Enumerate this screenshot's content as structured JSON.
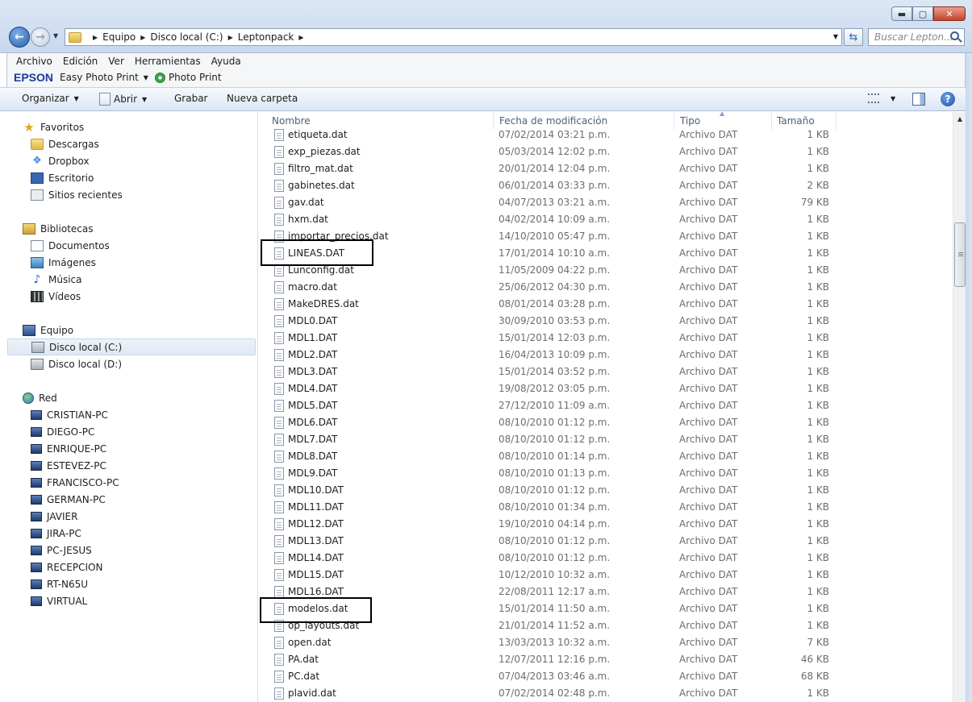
{
  "address": {
    "crumbs": [
      "Equipo",
      "Disco local (C:)",
      "Leptonpack"
    ]
  },
  "search": {
    "placeholder": "Buscar Lepton..."
  },
  "menu": [
    "Archivo",
    "Edición",
    "Ver",
    "Herramientas",
    "Ayuda"
  ],
  "epson": {
    "brand": "EPSON",
    "app": "Easy Photo Print",
    "photo_print": "Photo Print"
  },
  "toolbar": {
    "organize": "Organizar",
    "open": "Abrir",
    "burn": "Grabar",
    "new_folder": "Nueva carpeta"
  },
  "nav": {
    "favorites": "Favoritos",
    "downloads": "Descargas",
    "dropbox": "Dropbox",
    "desktop": "Escritorio",
    "recent": "Sitios recientes",
    "libraries": "Bibliotecas",
    "documents": "Documentos",
    "images": "Imágenes",
    "music": "Música",
    "videos": "Vídeos",
    "computer": "Equipo",
    "disk_c": "Disco local (C:)",
    "disk_d": "Disco local (D:)",
    "network": "Red",
    "hosts": [
      "CRISTIAN-PC",
      "DIEGO-PC",
      "ENRIQUE-PC",
      "ESTEVEZ-PC",
      "FRANCISCO-PC",
      "GERMAN-PC",
      "JAVIER",
      "JIRA-PC",
      "PC-JESUS",
      "RECEPCION",
      "RT-N65U",
      "VIRTUAL"
    ]
  },
  "columns": {
    "name": "Nombre",
    "date": "Fecha de modificación",
    "type": "Tipo",
    "size": "Tamaño"
  },
  "files": [
    {
      "name": "etiqueta.dat",
      "date": "07/02/2014 03:21 p.m.",
      "type": "Archivo DAT",
      "size": "1 KB"
    },
    {
      "name": "exp_piezas.dat",
      "date": "05/03/2014 12:02 p.m.",
      "type": "Archivo DAT",
      "size": "1 KB"
    },
    {
      "name": "filtro_mat.dat",
      "date": "20/01/2014 12:04 p.m.",
      "type": "Archivo DAT",
      "size": "1 KB"
    },
    {
      "name": "gabinetes.dat",
      "date": "06/01/2014 03:33 p.m.",
      "type": "Archivo DAT",
      "size": "2 KB"
    },
    {
      "name": "gav.dat",
      "date": "04/07/2013 03:21 a.m.",
      "type": "Archivo DAT",
      "size": "79 KB"
    },
    {
      "name": "hxm.dat",
      "date": "04/02/2014 10:09 a.m.",
      "type": "Archivo DAT",
      "size": "1 KB"
    },
    {
      "name": "importar_precios.dat",
      "date": "14/10/2010 05:47 p.m.",
      "type": "Archivo DAT",
      "size": "1 KB"
    },
    {
      "name": "LINEAS.DAT",
      "date": "17/01/2014 10:10 a.m.",
      "type": "Archivo DAT",
      "size": "1 KB"
    },
    {
      "name": "Lunconfig.dat",
      "date": "11/05/2009 04:22 p.m.",
      "type": "Archivo DAT",
      "size": "1 KB"
    },
    {
      "name": "macro.dat",
      "date": "25/06/2012 04:30 p.m.",
      "type": "Archivo DAT",
      "size": "1 KB"
    },
    {
      "name": "MakeDRES.dat",
      "date": "08/01/2014 03:28 p.m.",
      "type": "Archivo DAT",
      "size": "1 KB"
    },
    {
      "name": "MDL0.DAT",
      "date": "30/09/2010 03:53 p.m.",
      "type": "Archivo DAT",
      "size": "1 KB"
    },
    {
      "name": "MDL1.DAT",
      "date": "15/01/2014 12:03 p.m.",
      "type": "Archivo DAT",
      "size": "1 KB"
    },
    {
      "name": "MDL2.DAT",
      "date": "16/04/2013 10:09 p.m.",
      "type": "Archivo DAT",
      "size": "1 KB"
    },
    {
      "name": "MDL3.DAT",
      "date": "15/01/2014 03:52 p.m.",
      "type": "Archivo DAT",
      "size": "1 KB"
    },
    {
      "name": "MDL4.DAT",
      "date": "19/08/2012 03:05 p.m.",
      "type": "Archivo DAT",
      "size": "1 KB"
    },
    {
      "name": "MDL5.DAT",
      "date": "27/12/2010 11:09 a.m.",
      "type": "Archivo DAT",
      "size": "1 KB"
    },
    {
      "name": "MDL6.DAT",
      "date": "08/10/2010 01:12 p.m.",
      "type": "Archivo DAT",
      "size": "1 KB"
    },
    {
      "name": "MDL7.DAT",
      "date": "08/10/2010 01:12 p.m.",
      "type": "Archivo DAT",
      "size": "1 KB"
    },
    {
      "name": "MDL8.DAT",
      "date": "08/10/2010 01:14 p.m.",
      "type": "Archivo DAT",
      "size": "1 KB"
    },
    {
      "name": "MDL9.DAT",
      "date": "08/10/2010 01:13 p.m.",
      "type": "Archivo DAT",
      "size": "1 KB"
    },
    {
      "name": "MDL10.DAT",
      "date": "08/10/2010 01:12 p.m.",
      "type": "Archivo DAT",
      "size": "1 KB"
    },
    {
      "name": "MDL11.DAT",
      "date": "08/10/2010 01:34 p.m.",
      "type": "Archivo DAT",
      "size": "1 KB"
    },
    {
      "name": "MDL12.DAT",
      "date": "19/10/2010 04:14 p.m.",
      "type": "Archivo DAT",
      "size": "1 KB"
    },
    {
      "name": "MDL13.DAT",
      "date": "08/10/2010 01:12 p.m.",
      "type": "Archivo DAT",
      "size": "1 KB"
    },
    {
      "name": "MDL14.DAT",
      "date": "08/10/2010 01:12 p.m.",
      "type": "Archivo DAT",
      "size": "1 KB"
    },
    {
      "name": "MDL15.DAT",
      "date": "10/12/2010 10:32 a.m.",
      "type": "Archivo DAT",
      "size": "1 KB"
    },
    {
      "name": "MDL16.DAT",
      "date": "22/08/2011 12:17 a.m.",
      "type": "Archivo DAT",
      "size": "1 KB"
    },
    {
      "name": "modelos.dat",
      "date": "15/01/2014 11:50 a.m.",
      "type": "Archivo DAT",
      "size": "1 KB"
    },
    {
      "name": "op_layouts.dat",
      "date": "21/01/2014 11:52 a.m.",
      "type": "Archivo DAT",
      "size": "1 KB"
    },
    {
      "name": "open.dat",
      "date": "13/03/2013 10:32 a.m.",
      "type": "Archivo DAT",
      "size": "7 KB"
    },
    {
      "name": "PA.dat",
      "date": "12/07/2011 12:16 p.m.",
      "type": "Archivo DAT",
      "size": "46 KB"
    },
    {
      "name": "PC.dat",
      "date": "07/04/2013 03:46 a.m.",
      "type": "Archivo DAT",
      "size": "68 KB"
    },
    {
      "name": "plavid.dat",
      "date": "07/02/2014 02:48 p.m.",
      "type": "Archivo DAT",
      "size": "1 KB"
    }
  ]
}
